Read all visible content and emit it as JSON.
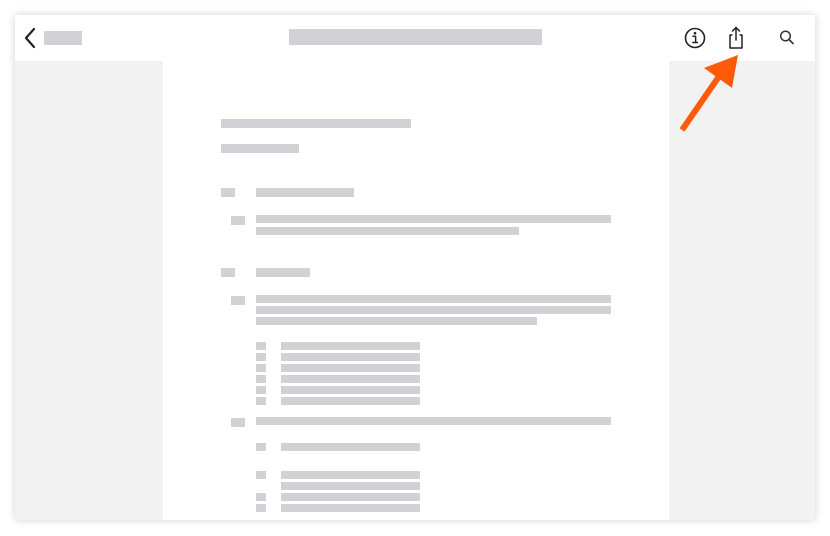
{
  "colors": {
    "placeholder": "#d2d2d6",
    "background": "#f2f2f2",
    "page": "#ffffff",
    "icon": "#222222",
    "annotation_arrow": "#ff5a0a"
  },
  "topbar": {
    "back_icon": "chevron-left-icon",
    "info_icon": "info-circle-icon",
    "share_icon": "share-icon",
    "search_icon": "search-icon"
  },
  "annotation": {
    "arrow_icon": "orange-arrow-pointing-to-share-icon"
  }
}
